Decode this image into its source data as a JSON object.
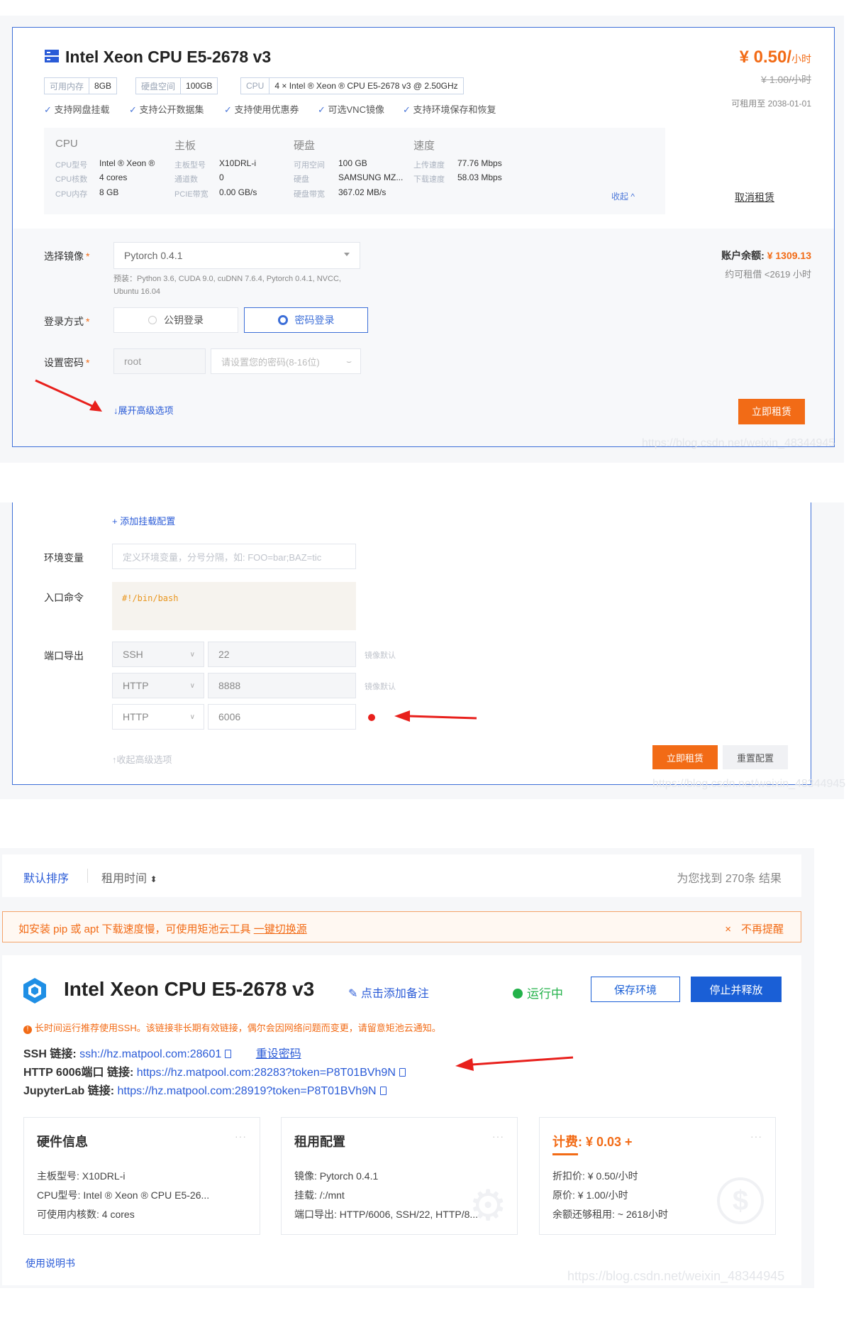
{
  "colors": {
    "accent": "#3d6fd8",
    "orange": "#f26b16",
    "blue_primary": "#1a5fd6",
    "running_green": "#23b24a"
  },
  "s1": {
    "title": "Intel Xeon CPU E5-2678 v3",
    "tags": [
      {
        "k": "可用内存",
        "v": "8GB"
      },
      {
        "k": "硬盘空间",
        "v": "100GB"
      },
      {
        "k": "CPU",
        "v": "4 × Intel ® Xeon ® CPU E5-2678 v3 @ 2.50GHz"
      }
    ],
    "features": [
      "支持网盘挂载",
      "支持公开数据集",
      "支持使用优惠券",
      "可选VNC镜像",
      "支持环境保存和恢复"
    ],
    "price": "¥ 0.50/",
    "price_unit": "小时",
    "orig_price": "¥ 1.00/小时",
    "rent_until": "可租用至 2038-01-01",
    "specs": {
      "cpu": {
        "h": "CPU",
        "rows": [
          [
            "CPU型号",
            "Intel ® Xeon ®"
          ],
          [
            "CPU核数",
            "4 cores"
          ],
          [
            "CPU内存",
            "8 GB"
          ]
        ]
      },
      "board": {
        "h": "主板",
        "rows": [
          [
            "主板型号",
            "X10DRL-i"
          ],
          [
            "通道数",
            "0"
          ],
          [
            "PCIE带宽",
            "0.00 GB/s"
          ]
        ]
      },
      "disk": {
        "h": "硬盘",
        "rows": [
          [
            "可用空间",
            "100 GB"
          ],
          [
            "硬盘",
            "SAMSUNG MZ..."
          ],
          [
            "硬盘带宽",
            "367.02 MB/s"
          ]
        ]
      },
      "speed": {
        "h": "速度",
        "rows": [
          [
            "上传速度",
            "77.76 Mbps"
          ],
          [
            "下载速度",
            "58.03 Mbps"
          ]
        ]
      }
    },
    "collapse": "收起",
    "cancel": "取消租赁",
    "image_label": "选择镜像",
    "image_value": "Pytorch 0.4.1",
    "preinstall": "预装：Python 3.6, CUDA 9.0, cuDNN 7.6.4, Pytorch 0.4.1, NVCC, Ubuntu 16.04",
    "login_label": "登录方式",
    "login_pub": "公钥登录",
    "login_pwd": "密码登录",
    "pwd_label": "设置密码",
    "pwd_user": "root",
    "pwd_placeholder": "请设置您的密码(8-16位)",
    "advanced": "↓展开高级选项",
    "balance_label": "账户余额:",
    "balance_value": "¥ 1309.13",
    "balance_hours": "约可租借 <2619 小时",
    "rent_now": "立即租赁",
    "wm": "https://blog.csdn.net/weixin_48344945"
  },
  "s2": {
    "add_mount": "+ 添加挂载配置",
    "env_label": "环境变量",
    "env_placeholder": "定义环境变量，分号分隔，如: FOO=bar;BAZ=tic",
    "entry_label": "入口命令",
    "entry_value": "#!/bin/bash",
    "port_label": "端口导出",
    "ports": [
      {
        "proto": "SSH",
        "port": "22",
        "note": "镜像默认"
      },
      {
        "proto": "HTTP",
        "port": "8888",
        "note": "镜像默认"
      },
      {
        "proto": "HTTP",
        "port": "6006",
        "note": ""
      }
    ],
    "collapse_adv": "↑收起高级选项",
    "rent_now": "立即租赁",
    "reset": "重置配置",
    "wm": "https://blog.csdn.net/weixin_48344945"
  },
  "s3": {
    "sort_default": "默认排序",
    "sort_time": "租用时间",
    "result": "为您找到 270条 结果",
    "notice": "如安装 pip 或 apt 下载速度慢，可使用矩池云工具 ",
    "notice_link": "一键切换源",
    "dismiss": "不再提醒",
    "title": "Intel Xeon CPU E5-2678 v3",
    "add_note": "点击添加备注",
    "status": "运行中",
    "save_env": "保存环境",
    "stop": "停止并释放",
    "warn": "长时间运行推荐使用SSH。该链接非长期有效链接，偶尔会因网络问题而变更，请留意矩池云通知。",
    "ssh_label": "SSH 链接:",
    "ssh_value": "ssh://hz.matpool.com:28601",
    "reset_pwd": "重设密码",
    "http_label": "HTTP 6006端口 链接:",
    "http_value": "https://hz.matpool.com:28283?token=P8T01BVh9N",
    "jl_label": "JupyterLab 链接:",
    "jl_value": "https://hz.matpool.com:28919?token=P8T01BVh9N",
    "hw": {
      "t": "硬件信息",
      "l1": "主板型号: X10DRL-i",
      "l2": "CPU型号: Intel ® Xeon ® CPU E5-26...",
      "l3": "可使用内核数: 4 cores"
    },
    "rent": {
      "t": "租用配置",
      "l1": "镜像: Pytorch 0.4.1",
      "l2": "挂载: /:/mnt",
      "l3": "端口导出: HTTP/6006, SSH/22, HTTP/8..."
    },
    "fee": {
      "t": "计费: ¥ 0.03 +",
      "l1": "折扣价: ¥ 0.50/小时",
      "l2": "原价: ¥ 1.00/小时",
      "l3": "余额还够租用: ~ 2618小时"
    },
    "manual": "使用说明书",
    "wm": "https://blog.csdn.net/weixin_48344945"
  }
}
